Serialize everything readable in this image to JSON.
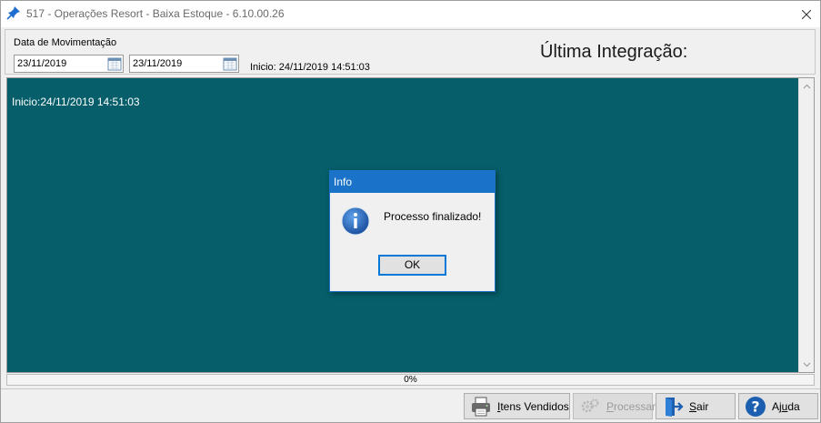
{
  "window": {
    "title": "517 - Operações Resort - Baixa Estoque - 6.10.00.26"
  },
  "top_panel": {
    "date_label": "Data de Movimentação",
    "date_start": "23/11/2019",
    "date_end": "23/11/2019",
    "inicio_label": "Inicio: 24/11/2019 14:51:03",
    "ultima_integracao_label": "Última Integração:"
  },
  "log": {
    "text": "Inicio:24/11/2019 14:51:03",
    "background_color": "#065e6a"
  },
  "progress": {
    "value_percent": 0,
    "label": "0%"
  },
  "buttons": {
    "itens_vendidos": {
      "accel": "I",
      "rest": "tens Vendidos"
    },
    "processar": {
      "accel": "P",
      "rest": "rocessar",
      "enabled": false
    },
    "sair": {
      "accel": "S",
      "rest": "air"
    },
    "ajuda": {
      "pre": "Aj",
      "accel": "u",
      "post": "da"
    }
  },
  "dialog": {
    "title": "Info",
    "message": "Processo finalizado!",
    "ok_label": "OK",
    "icon": "info-icon"
  }
}
